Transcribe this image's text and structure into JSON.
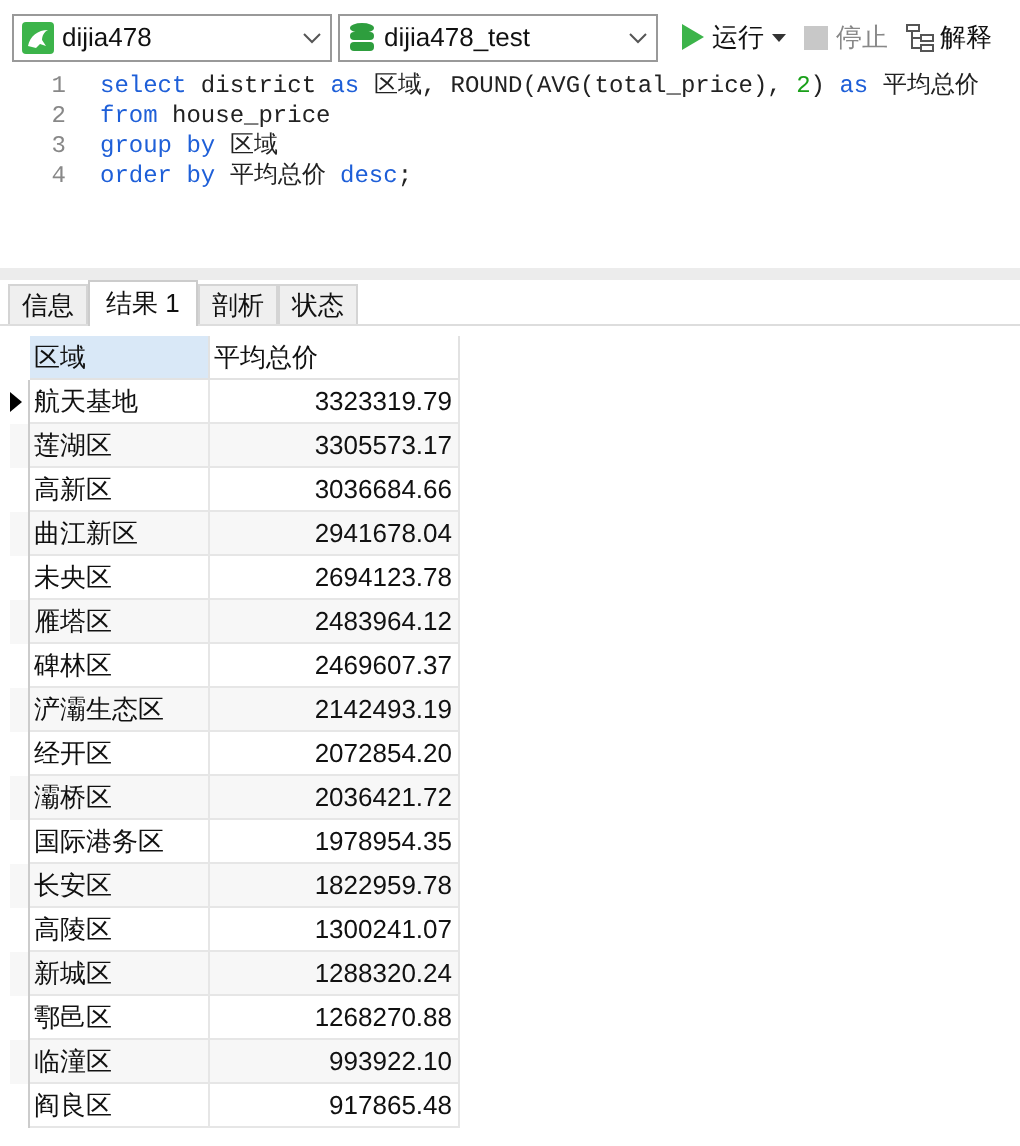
{
  "toolbar": {
    "connection": "dijia478",
    "database": "dijia478_test",
    "run": "运行",
    "stop": "停止",
    "explain": "解释"
  },
  "editor": {
    "lines": [
      {
        "number": "1",
        "tokens": [
          {
            "text": "select",
            "kind": "keyword"
          },
          {
            "text": " district ",
            "kind": "plain"
          },
          {
            "text": "as",
            "kind": "keyword"
          },
          {
            "text": " 区域, ROUND(AVG(total_price), ",
            "kind": "plain"
          },
          {
            "text": "2",
            "kind": "number"
          },
          {
            "text": ") ",
            "kind": "plain"
          },
          {
            "text": "as",
            "kind": "keyword"
          },
          {
            "text": " 平均总价",
            "kind": "plain"
          }
        ]
      },
      {
        "number": "2",
        "tokens": [
          {
            "text": "from",
            "kind": "keyword"
          },
          {
            "text": " house_price",
            "kind": "plain"
          }
        ]
      },
      {
        "number": "3",
        "tokens": [
          {
            "text": "group by",
            "kind": "keyword"
          },
          {
            "text": " 区域",
            "kind": "plain"
          }
        ]
      },
      {
        "number": "4",
        "tokens": [
          {
            "text": "order by",
            "kind": "keyword"
          },
          {
            "text": " 平均总价 ",
            "kind": "plain"
          },
          {
            "text": "desc",
            "kind": "keyword"
          },
          {
            "text": ";",
            "kind": "plain"
          }
        ]
      }
    ]
  },
  "tabs": [
    {
      "label": "信息",
      "selected": false
    },
    {
      "label": "结果 1",
      "selected": true
    },
    {
      "label": "剖析",
      "selected": false
    },
    {
      "label": "状态",
      "selected": false
    }
  ],
  "table": {
    "columns": [
      "区域",
      "平均总价"
    ],
    "rows": [
      {
        "cells": [
          "航天基地",
          "3323319.79"
        ],
        "selected": true
      },
      {
        "cells": [
          "莲湖区",
          "3305573.17"
        ],
        "selected": false
      },
      {
        "cells": [
          "高新区",
          "3036684.66"
        ],
        "selected": false
      },
      {
        "cells": [
          "曲江新区",
          "2941678.04"
        ],
        "selected": false
      },
      {
        "cells": [
          "未央区",
          "2694123.78"
        ],
        "selected": false
      },
      {
        "cells": [
          "雁塔区",
          "2483964.12"
        ],
        "selected": false
      },
      {
        "cells": [
          "碑林区",
          "2469607.37"
        ],
        "selected": false
      },
      {
        "cells": [
          "浐灞生态区",
          "2142493.19"
        ],
        "selected": false
      },
      {
        "cells": [
          "经开区",
          "2072854.20"
        ],
        "selected": false
      },
      {
        "cells": [
          "灞桥区",
          "2036421.72"
        ],
        "selected": false
      },
      {
        "cells": [
          "国际港务区",
          "1978954.35"
        ],
        "selected": false
      },
      {
        "cells": [
          "长安区",
          "1822959.78"
        ],
        "selected": false
      },
      {
        "cells": [
          "高陵区",
          "1300241.07"
        ],
        "selected": false
      },
      {
        "cells": [
          "新城区",
          "1288320.24"
        ],
        "selected": false
      },
      {
        "cells": [
          "鄠邑区",
          "1268270.88"
        ],
        "selected": false
      },
      {
        "cells": [
          "临潼区",
          "993922.10"
        ],
        "selected": false
      },
      {
        "cells": [
          "阎良区",
          "917865.48"
        ],
        "selected": false
      }
    ]
  }
}
